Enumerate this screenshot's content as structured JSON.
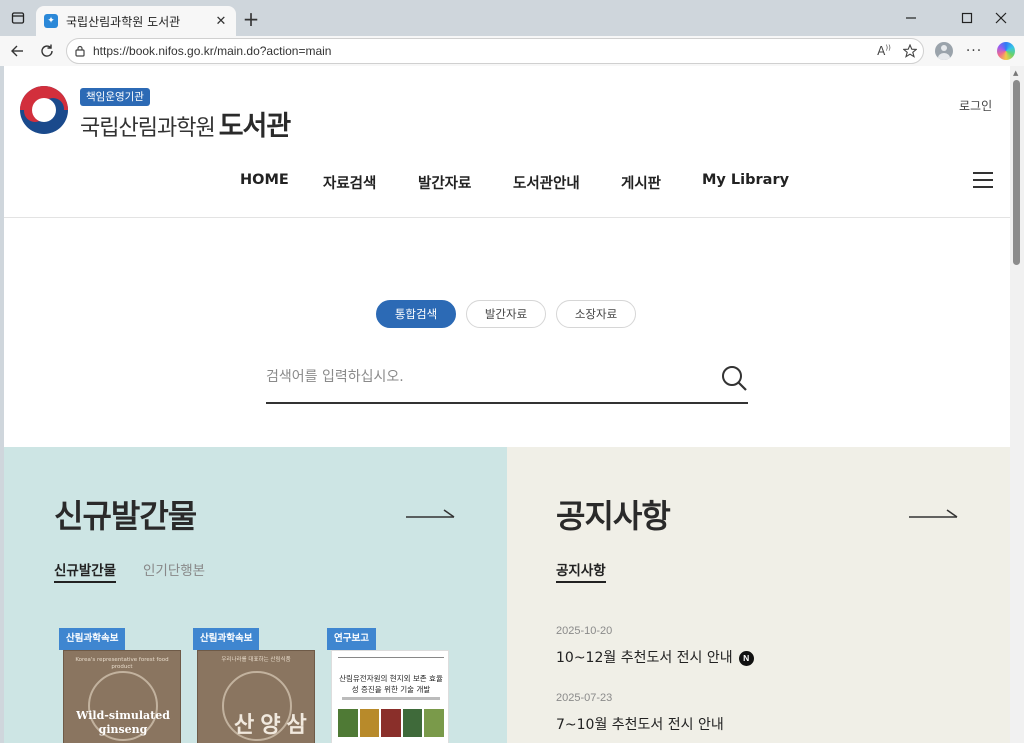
{
  "browser": {
    "tab_title": "국립산림과학원 도서관",
    "tab_favicon": "✦",
    "url": "https://book.nifos.go.kr/main.do?action=main"
  },
  "header": {
    "badge": "책임운영기관",
    "brand_small": "국립산림과학원",
    "brand_big": "도서관",
    "login": "로그인"
  },
  "nav": {
    "items": [
      "HOME",
      "자료검색",
      "발간자료",
      "도서관안내",
      "게시판",
      "My Library"
    ]
  },
  "search": {
    "tabs": [
      "통합검색",
      "발간자료",
      "소장자료"
    ],
    "active_tab": "통합검색",
    "placeholder": "검색어를 입력하십시오."
  },
  "new_pubs": {
    "title": "신규발간물",
    "tabs": [
      "신규발간물",
      "인기단행본"
    ],
    "books": [
      {
        "tag": "산림과학속보",
        "cover_small": "Korea's representative forest food product",
        "cover_main": "Wild-simulated ginseng"
      },
      {
        "tag": "산림과학속보",
        "cover_small": "우리나라를 대표하는 산림식품",
        "cover_main": "산양삼"
      },
      {
        "tag": "연구보고",
        "cover_title": "산림유전자원의 현지외 보존 효율성 증진을 위한 기술 개발"
      }
    ]
  },
  "notices": {
    "title": "공지사항",
    "tab": "공지사항",
    "items": [
      {
        "date": "2025-10-20",
        "title": "10~12월 추천도서 전시 안내",
        "new": "N"
      },
      {
        "date": "2025-07-23",
        "title": "7~10월 추천도서 전시 안내"
      }
    ]
  },
  "colors": {
    "accent": "#2c6ab5",
    "tag_blue": "#3f86d0",
    "panel_left": "#cde5e4",
    "panel_right": "#f0efe7"
  }
}
